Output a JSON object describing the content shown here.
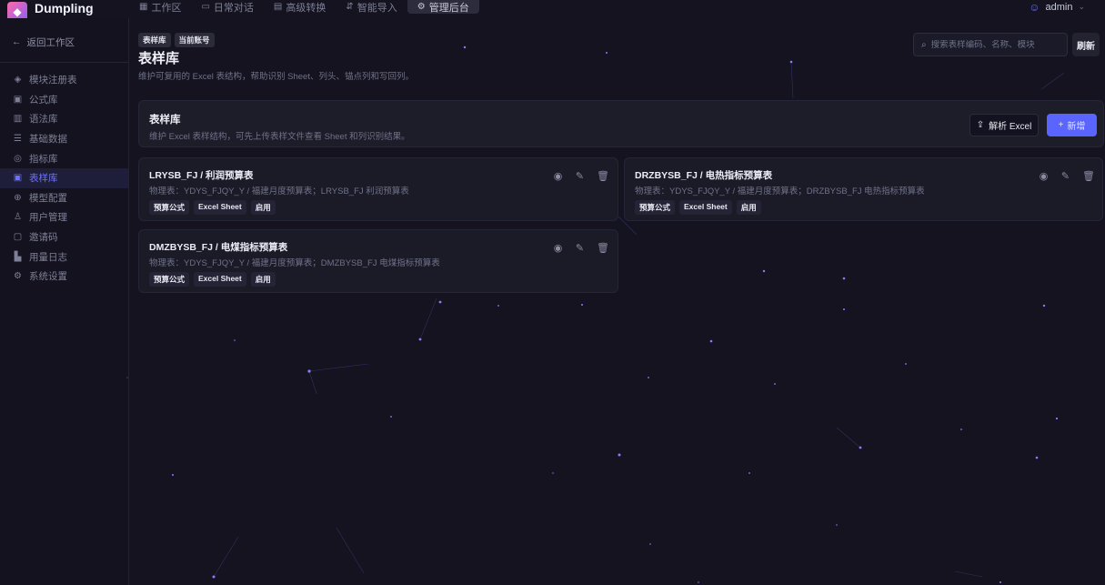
{
  "app": {
    "brand": "Dumpling",
    "user": "admin"
  },
  "nav": [
    {
      "label": "工作区",
      "icon": "grid-icon"
    },
    {
      "label": "日常对话",
      "icon": "chat-icon"
    },
    {
      "label": "高级转换",
      "icon": "convert-icon"
    },
    {
      "label": "智能导入",
      "icon": "import-icon"
    },
    {
      "label": "管理后台",
      "icon": "gear-icon",
      "active": true
    }
  ],
  "sidebar": {
    "back_label": "返回工作区",
    "items": [
      {
        "label": "模块注册表",
        "icon": "layers-icon"
      },
      {
        "label": "公式库",
        "icon": "formula-icon"
      },
      {
        "label": "语法库",
        "icon": "book-icon"
      },
      {
        "label": "基础数据",
        "icon": "database-icon"
      },
      {
        "label": "指标库",
        "icon": "target-icon"
      },
      {
        "label": "表样库",
        "icon": "table-icon",
        "active": true
      },
      {
        "label": "模型配置",
        "icon": "model-icon"
      },
      {
        "label": "用户管理",
        "icon": "users-icon"
      },
      {
        "label": "邀请码",
        "icon": "ticket-icon"
      },
      {
        "label": "用量日志",
        "icon": "chart-icon"
      },
      {
        "label": "系统设置",
        "icon": "settings-icon"
      }
    ]
  },
  "header": {
    "breadcrumbs": [
      "表样库",
      "当前账号"
    ],
    "title": "表样库",
    "description": "维护可复用的 Excel 表结构，帮助识别 Sheet、列头、锚点列和写回列。",
    "search_placeholder": "搜索表样编码、名称、模块",
    "refresh_label": "刷新"
  },
  "section": {
    "title": "表样库",
    "description": "维护 Excel 表样结构，可先上传表样文件查看 Sheet 和列识别结果。",
    "parse_label": "解析 Excel",
    "add_label": "新增"
  },
  "cards": [
    {
      "title": "LRYSB_FJ / 利润预算表",
      "description": "物理表：YDYS_FJQY_Y / 福建月度预算表；LRYSB_FJ 利润预算表",
      "tags": [
        "预算公式",
        "Excel Sheet",
        "启用"
      ]
    },
    {
      "title": "DRZBYSB_FJ / 电热指标预算表",
      "description": "物理表：YDYS_FJQY_Y / 福建月度预算表；DRZBYSB_FJ 电热指标预算表",
      "tags": [
        "预算公式",
        "Excel Sheet",
        "启用"
      ]
    },
    {
      "title": "DMZBYSB_FJ / 电煤指标预算表",
      "description": "物理表：YDYS_FJQY_Y / 福建月度预算表；DMZBYSB_FJ 电煤指标预算表",
      "tags": [
        "预算公式",
        "Excel Sheet",
        "启用"
      ]
    }
  ],
  "icons": {
    "view": "eye-icon",
    "edit": "pencil-icon",
    "delete": "trash-icon",
    "upload": "upload-icon",
    "plus": "plus-icon"
  },
  "colors": {
    "background": "#14131f",
    "accent": "#5a64ff",
    "sidebar_active_bg": "#1f1e3a",
    "card_bg": "#1c1c2a"
  }
}
